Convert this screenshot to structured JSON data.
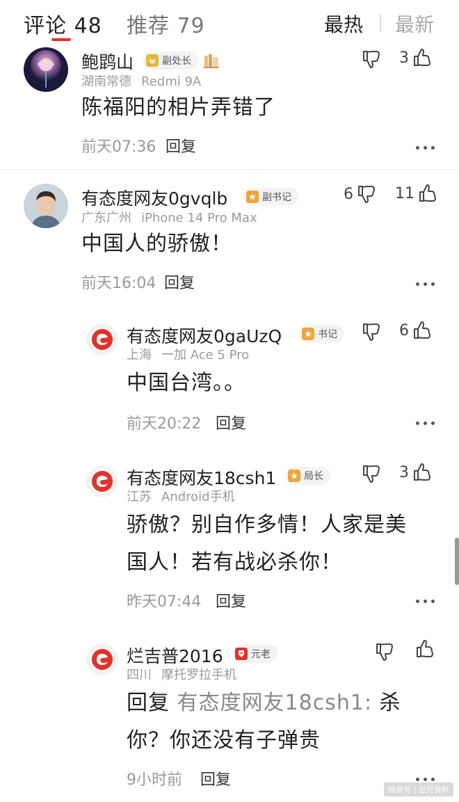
{
  "header": {
    "tab_comments": "评论 48",
    "tab_recommend": "推荐 79",
    "sort_hot": "最热",
    "sort_new": "最新"
  },
  "comments": [
    {
      "username": "鲍鹍山",
      "badge": "副处长",
      "badge_color": "#e8b53a",
      "location": "湖南常德",
      "device": "Redmi 9A",
      "text": "陈福阳的相片弄错了",
      "time": "前天07:36",
      "reply": "回复",
      "dislikes": "",
      "likes": "3"
    },
    {
      "username": "有态度网友0gvqlb",
      "badge": "副书记",
      "badge_color": "#f0a43a",
      "location": "广东广州",
      "device": "iPhone 14 Pro Max",
      "text": "中国人的骄傲！",
      "time": "前天16:04",
      "reply": "回复",
      "dislikes": "6",
      "likes": "11"
    },
    {
      "username": "有态度网友0gaUzQ",
      "badge": "书记",
      "badge_color": "#f0a43a",
      "location": "上海",
      "device": "一加 Ace 5 Pro",
      "text": "中国台湾。。",
      "time": "前天20:22",
      "reply": "回复",
      "dislikes": "",
      "likes": "6"
    },
    {
      "username": "有态度网友18csh1",
      "badge": "局长",
      "badge_color": "#f0a43a",
      "location": "江苏",
      "device": "Android手机",
      "text_line1": "骄傲？别自作多情！人家是美",
      "text_line2": "国人！若有战必杀你！",
      "time": "昨天07:44",
      "reply": "回复",
      "dislikes": "",
      "likes": "3"
    },
    {
      "username": "烂吉普2016",
      "badge": "元老",
      "badge_color": "#e0332b",
      "location": "四川",
      "device": "摩托罗拉手机",
      "reply_prefix": "回复",
      "reply_target": "有态度网友18csh1:",
      "text_line1_tail": "杀",
      "text_line2": "你？你还没有子弹贵",
      "time": "9小时前",
      "reply": "回复",
      "dislikes": "",
      "likes": ""
    }
  ],
  "watermark": "网易号 | 旦月资料"
}
